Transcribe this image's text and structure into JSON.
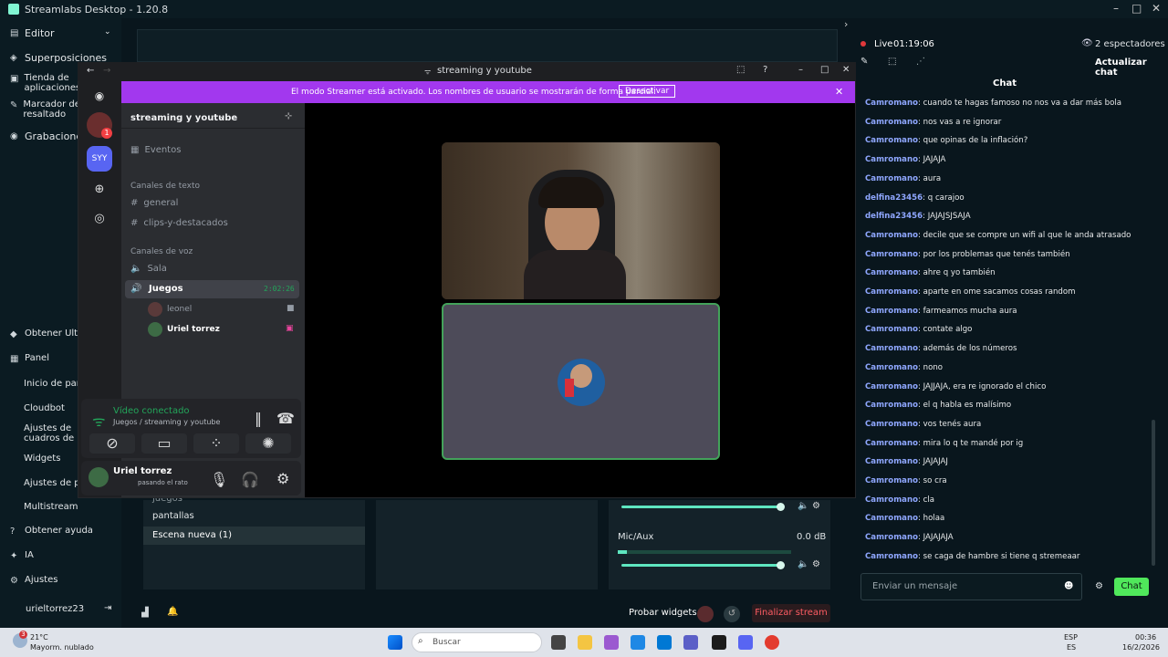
{
  "app": {
    "title": "Streamlabs Desktop - 1.20.8"
  },
  "nav": {
    "top": [
      "Editor",
      "Superposiciones",
      "Tienda de aplicaciones",
      "Marcador de resaltado",
      "Grabaciones"
    ],
    "bottom": [
      "Obtener Ultra",
      "Panel"
    ],
    "panel_items": [
      "Inicio de panel",
      "Cloudbot",
      "Ajustes de cuadros de alertas",
      "Widgets",
      "Ajustes de pro",
      "Multistream"
    ],
    "lower": [
      "Obtener ayuda",
      "IA",
      "Ajustes"
    ],
    "username": "urieltorrez23"
  },
  "stream": {
    "live_label": "Live",
    "live_time": "01:19:06",
    "viewers": "2 espectadores",
    "refresh_chat": "Actualizar chat",
    "chat_title": "Chat"
  },
  "chat": [
    {
      "u": "Camromano",
      "m": "cuando te hagas famoso no nos va a dar más bola"
    },
    {
      "u": "Camromano",
      "m": "nos vas a re ignorar"
    },
    {
      "u": "Camromano",
      "m": "que opinas de la inflación?"
    },
    {
      "u": "Camromano",
      "m": "JAJAJA"
    },
    {
      "u": "Camromano",
      "m": "aura"
    },
    {
      "u": "delfina23456",
      "m": "q carajoo"
    },
    {
      "u": "delfina23456",
      "m": "JAJAJSJSAJA"
    },
    {
      "u": "Camromano",
      "m": "decile que se compre un wifi al que le anda atrasado"
    },
    {
      "u": "Camromano",
      "m": "por los problemas que tenés también"
    },
    {
      "u": "Camromano",
      "m": "ahre q yo también"
    },
    {
      "u": "Camromano",
      "m": "aparte en ome sacamos cosas random"
    },
    {
      "u": "Camromano",
      "m": "farmeamos mucha aura"
    },
    {
      "u": "Camromano",
      "m": "contate algo"
    },
    {
      "u": "Camromano",
      "m": "además de los números"
    },
    {
      "u": "Camromano",
      "m": "nono"
    },
    {
      "u": "Camromano",
      "m": "JAJJAJA, era re ignorado el chico"
    },
    {
      "u": "Camromano",
      "m": "el q habla es malísimo"
    },
    {
      "u": "Camromano",
      "m": "vos tenés aura"
    },
    {
      "u": "Camromano",
      "m": "mira lo q te mandé por ig"
    },
    {
      "u": "Camromano",
      "m": "JAJAJAJ"
    },
    {
      "u": "Camromano",
      "m": "so cra"
    },
    {
      "u": "Camromano",
      "m": "cla"
    },
    {
      "u": "Camromano",
      "m": "holaa"
    },
    {
      "u": "Camromano",
      "m": "JAJAJAJA"
    },
    {
      "u": "Camromano",
      "m": "se caga de hambre si tiene q stremeaar"
    }
  ],
  "chat_input": {
    "placeholder": "Enviar un mensaje",
    "send": "Chat"
  },
  "scenes": {
    "items": [
      "juegos",
      "pantallas",
      "Escena nueva (1)"
    ]
  },
  "mixer": {
    "source": "Mic/Aux",
    "db": "0.0 dB"
  },
  "bottom": {
    "test_widgets": "Probar widgets",
    "end_stream": "Finalizar stream"
  },
  "discord": {
    "window_title": "streaming y youtube",
    "banner_text": "El modo Streamer está activado. Los nombres de usuario se mostrarán de forma parcial.",
    "banner_button": "Desactivar",
    "server_name": "streaming y youtube",
    "server_badge": "SYY",
    "events": "Eventos",
    "text_category": "Canales de texto",
    "text_channels": [
      "general",
      "clips-y-destacados"
    ],
    "voice_category": "Canales de voz",
    "voice_channels": [
      "Sala",
      "Juegos"
    ],
    "voice_timer": "2:02:26",
    "voice_users": [
      "leonel",
      "Uriel torrez"
    ],
    "voice_status": "Vídeo conectado",
    "voice_path": "Juegos / streaming y youtube",
    "user_name": "Uriel torrez",
    "user_status": "pasando el rato",
    "notif": "1"
  },
  "taskbar": {
    "weather_temp": "21°C",
    "weather_desc": "Mayorm. nublado",
    "search": "Buscar",
    "lang": "ESP",
    "lang2": "ES",
    "time": "00:36",
    "date": "16/2/2026",
    "badge": "3"
  },
  "colors": {
    "accent": "#80f5d2",
    "streamer_banner": "#a238ee",
    "chat_user": "#8fa7ff",
    "live": "#e0383b"
  }
}
